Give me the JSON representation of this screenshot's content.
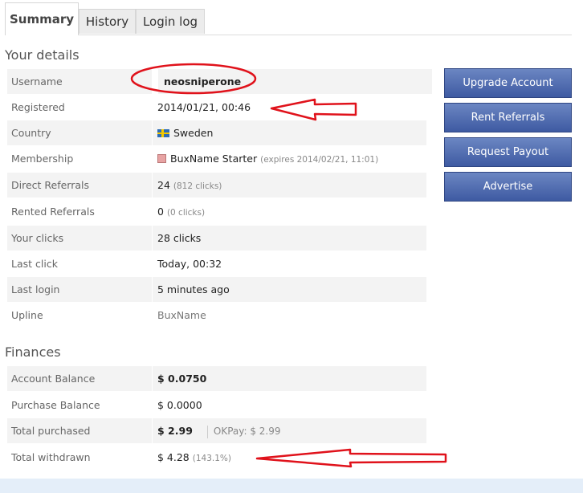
{
  "tabs": [
    {
      "label": "Summary",
      "active": true
    },
    {
      "label": "History",
      "active": false
    },
    {
      "label": "Login log",
      "active": false
    }
  ],
  "details": {
    "title": "Your details",
    "rows": {
      "username": {
        "label": "Username",
        "value": "neosniperone"
      },
      "registered": {
        "label": "Registered",
        "value": "2014/01/21, 00:46"
      },
      "country": {
        "label": "Country",
        "value": "Sweden",
        "icon": "sweden-flag-icon"
      },
      "membership": {
        "label": "Membership",
        "value": "BuxName Starter",
        "note": "(expires 2014/02/21, 11:01)",
        "icon": "membership-icon"
      },
      "direct_referrals": {
        "label": "Direct Referrals",
        "value": "24",
        "note": "(812 clicks)"
      },
      "rented_referrals": {
        "label": "Rented Referrals",
        "value": "0",
        "note": "(0 clicks)"
      },
      "your_clicks": {
        "label": "Your clicks",
        "value": "28 clicks"
      },
      "last_click": {
        "label": "Last click",
        "value": "Today, 00:32"
      },
      "last_login": {
        "label": "Last login",
        "value": "5 minutes ago"
      },
      "upline": {
        "label": "Upline",
        "value": "BuxName"
      }
    }
  },
  "finances": {
    "title": "Finances",
    "rows": {
      "account_balance": {
        "label": "Account Balance",
        "value": "$ 0.0750"
      },
      "purchase_balance": {
        "label": "Purchase Balance",
        "value": "$ 0.0000"
      },
      "total_purchased": {
        "label": "Total purchased",
        "value": "$ 2.99",
        "extra": "OKPay: $ 2.99"
      },
      "total_withdrawn": {
        "label": "Total withdrawn",
        "value": "$ 4.28",
        "note": "(143.1%)"
      }
    }
  },
  "buttons": {
    "upgrade": "Upgrade Account",
    "rent": "Rent Referrals",
    "payout": "Request Payout",
    "advertise": "Advertise"
  },
  "colors": {
    "button_top": "#6b86c2",
    "button_bottom": "#3e5aa2",
    "annotation_red": "#e0121b",
    "row_shade": "#f3f3f3"
  }
}
